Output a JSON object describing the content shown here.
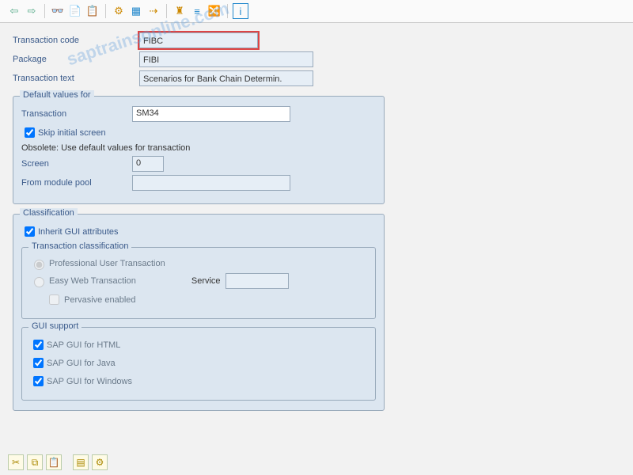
{
  "header": {
    "transaction_code_label": "Transaction code",
    "transaction_code": "FIBC",
    "package_label": "Package",
    "package": "FIBI",
    "transaction_text_label": "Transaction text",
    "transaction_text": "Scenarios for Bank Chain Determin."
  },
  "defaults": {
    "title": "Default values for",
    "transaction_label": "Transaction",
    "transaction": "SM34",
    "skip_label": "Skip initial screen",
    "skip": true,
    "obsolete_text": "Obsolete: Use default values for transaction",
    "screen_label": "Screen",
    "screen": "0",
    "from_pool_label": "From module pool",
    "from_pool": ""
  },
  "classification": {
    "title": "Classification",
    "inherit_label": "Inherit GUI attributes",
    "inherit": true,
    "trans_class_title": "Transaction classification",
    "pro_label": "Professional User Transaction",
    "easy_label": "Easy Web Transaction",
    "service_label": "Service",
    "service": "",
    "pervasive_label": "Pervasive enabled",
    "pervasive": false,
    "gui_title": "GUI support",
    "gui_html_label": "SAP GUI for HTML",
    "gui_java_label": "SAP GUI for Java",
    "gui_win_label": "SAP GUI for Windows",
    "gui_html": true,
    "gui_java": true,
    "gui_win": true
  },
  "watermark": "saptrainsonline.com"
}
